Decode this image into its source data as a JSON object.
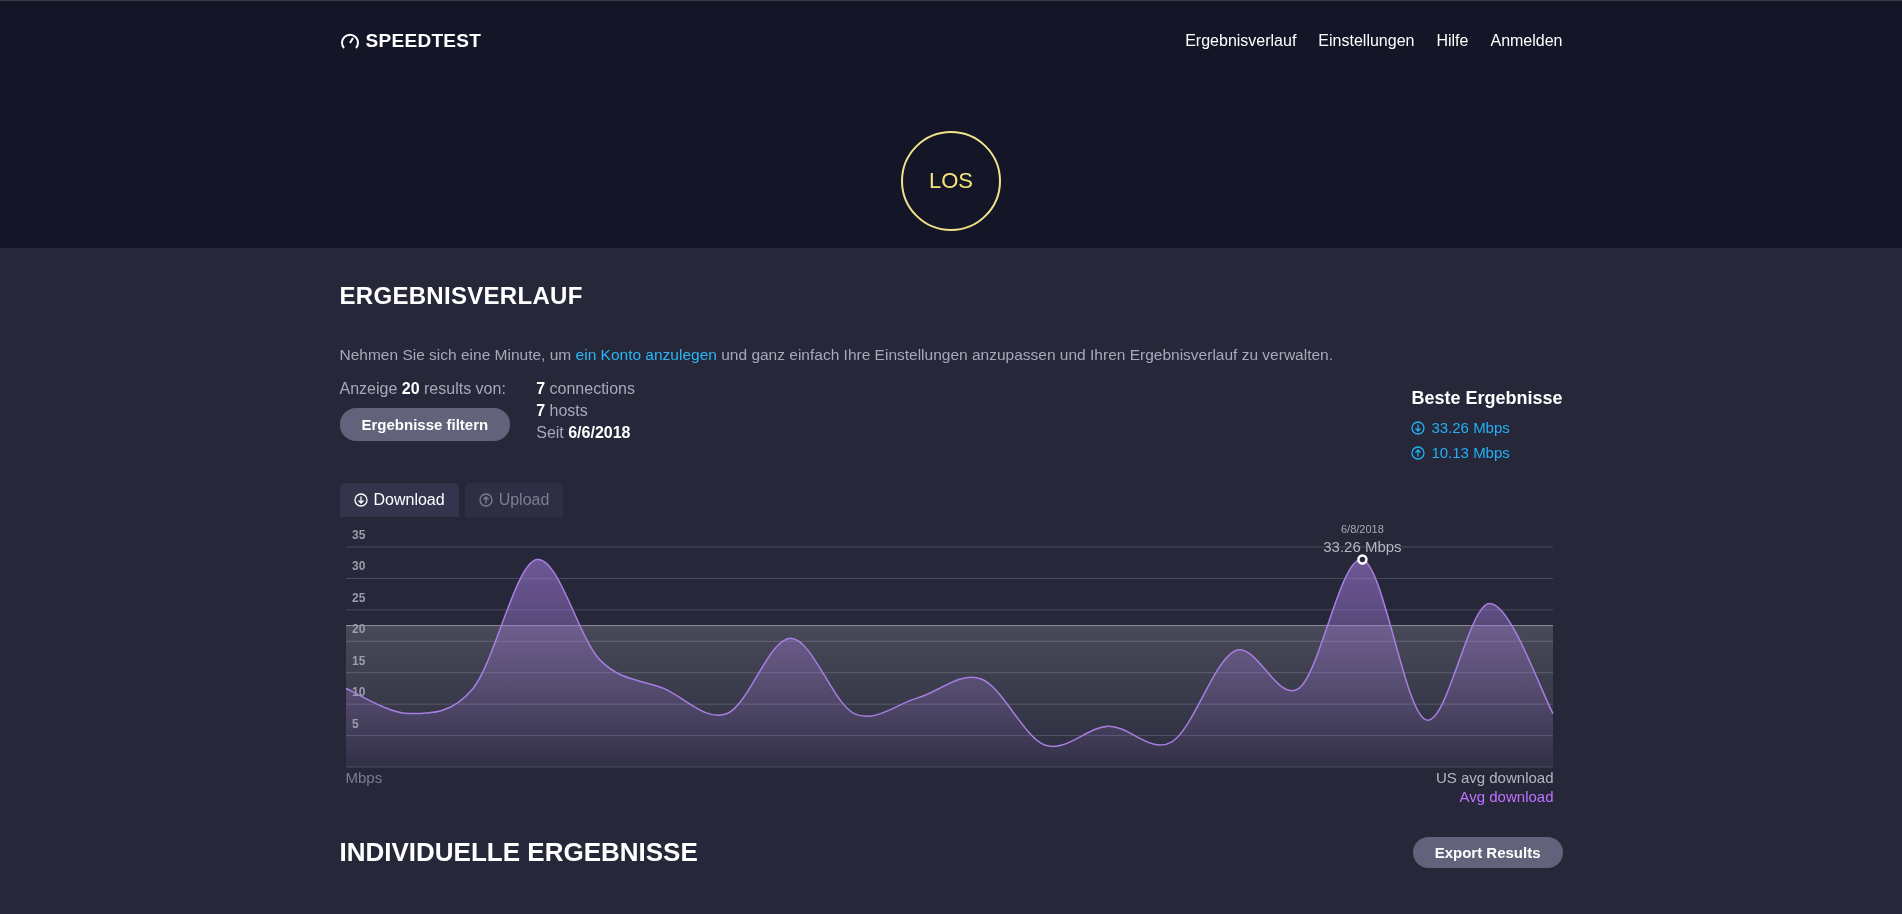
{
  "header": {
    "logo": "SPEEDTEST",
    "nav": [
      "Ergebnisverlauf",
      "Einstellungen",
      "Hilfe",
      "Anmelden"
    ],
    "go_button": "LOS"
  },
  "history": {
    "title": "ERGEBNISVERLAUF",
    "intro": {
      "before": "Nehmen Sie sich eine Minute, um",
      "link": "ein Konto anzulegen",
      "after": "und ganz einfach Ihre Einstellungen anzupassen und Ihren Ergebnisverlauf zu verwalten."
    },
    "showing": "Anzeige **20** results von:",
    "filter_button": "Ergebnisse filtern",
    "stats": [
      "**7** connections",
      "**7** hosts",
      "Seit **6/6/2018**"
    ],
    "best": {
      "title": "Beste Ergebnisse",
      "items": [
        {
          "kind": "download",
          "value": "33.26 Mbps"
        },
        {
          "kind": "upload",
          "value": "10.13 Mbps"
        }
      ]
    },
    "tabs": [
      {
        "kind": "download",
        "label": "Download",
        "selected": true
      },
      {
        "kind": "upload",
        "label": "Upload",
        "selected": false
      }
    ],
    "chart_unit": "Mbps",
    "chart_data": {
      "type": "area",
      "ylim": [
        0,
        35
      ],
      "yticks": [
        5,
        10,
        15,
        20,
        25,
        30,
        35
      ],
      "grid": true,
      "series": [
        {
          "name": "Avg download",
          "color": "#bf72ff",
          "values": [
            12.5,
            8.5,
            12.5,
            33,
            17,
            12.5,
            8.5,
            20.5,
            8.5,
            11,
            14,
            3.5,
            6.5,
            4,
            18.5,
            12.5,
            33,
            7.5,
            26,
            8.5
          ]
        }
      ],
      "ref_lines": [
        {
          "axis": "y",
          "value": 22.5,
          "label": "US avg download",
          "color": "#b4b4c4"
        }
      ]
    },
    "tooltip": {
      "date": "6/8/2018",
      "value": "33.26 Mbps"
    }
  },
  "individual": {
    "title": "INDIVIDUELLE ERGEBNISSE",
    "export_button": "Export Results"
  }
}
